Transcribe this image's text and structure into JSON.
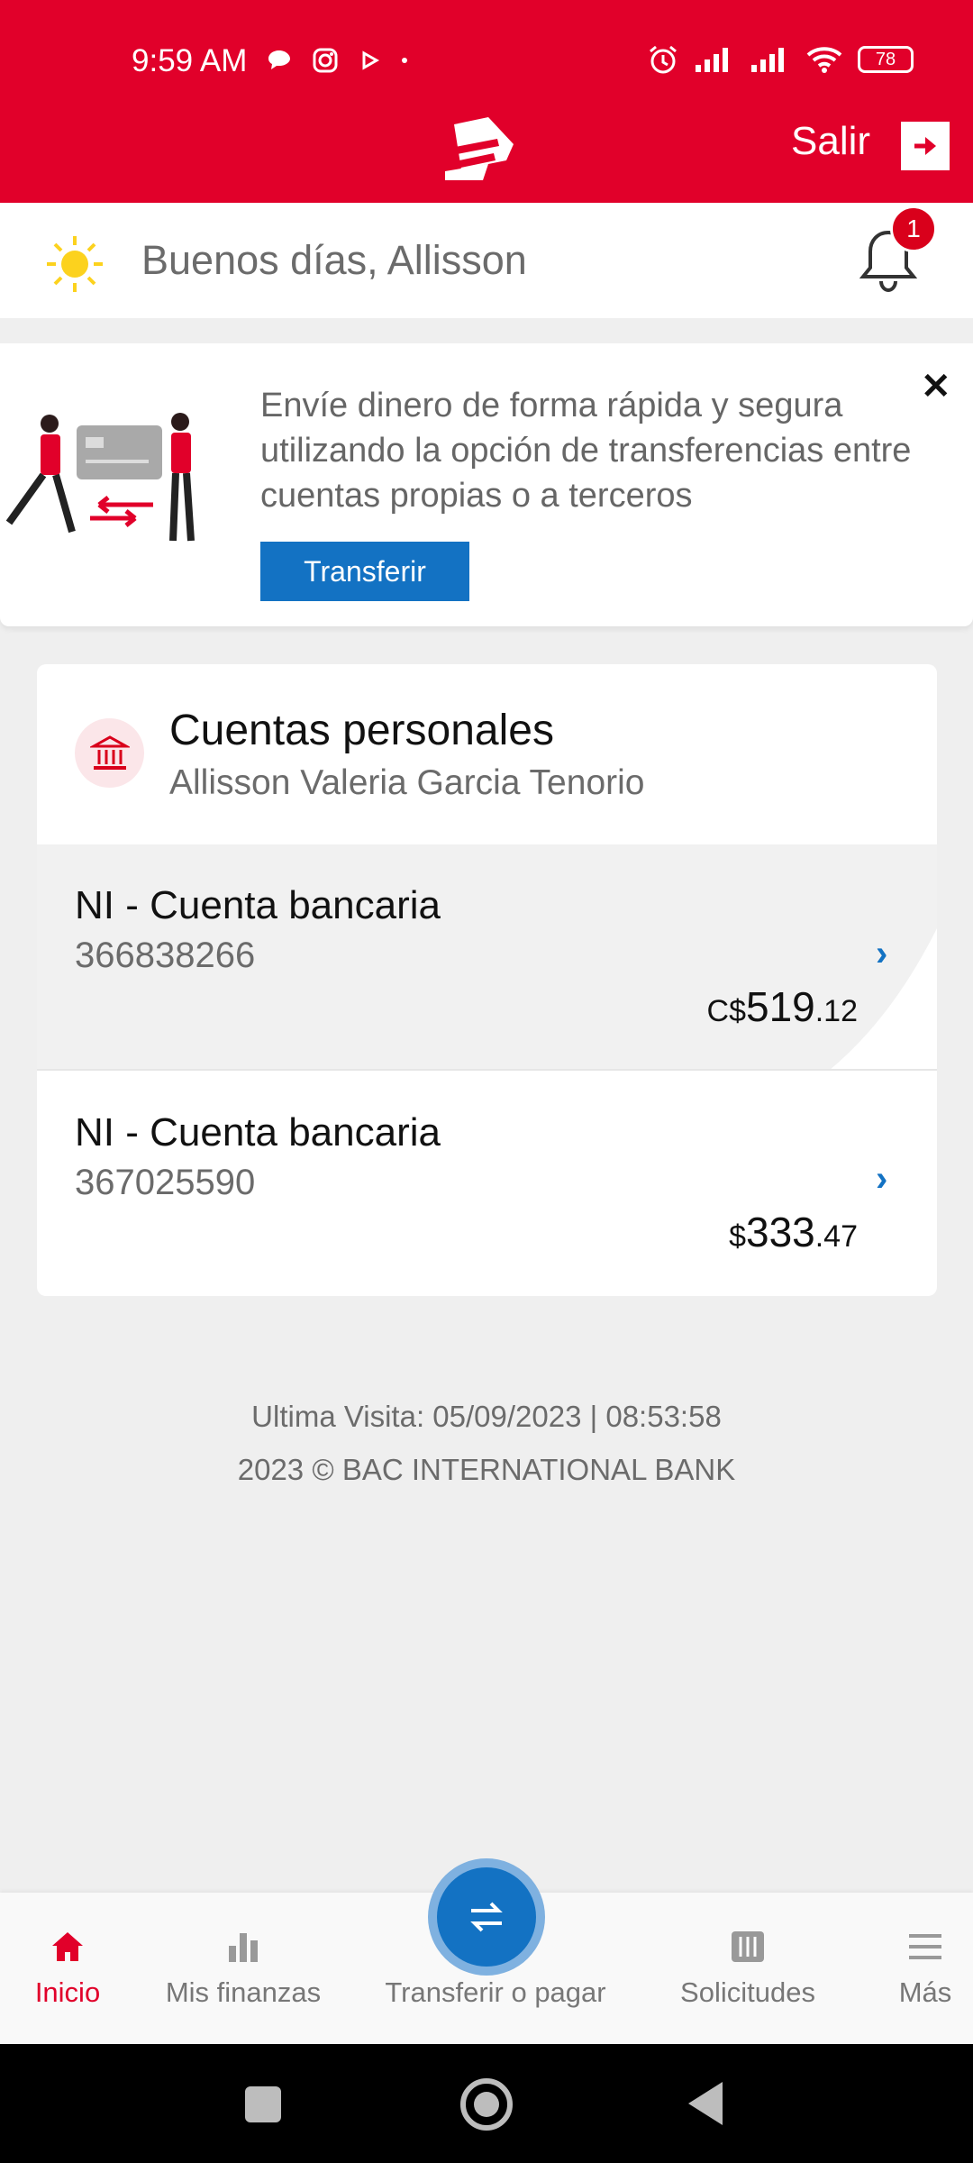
{
  "status_bar": {
    "time": "9:59 AM",
    "battery": "78"
  },
  "header": {
    "logout_label": "Salir"
  },
  "greeting": {
    "text": "Buenos días, Allisson",
    "notification_count": "1"
  },
  "promo": {
    "message": "Envíe dinero de forma rápida y segura utilizando la opción de transferencias entre cuentas propias o a terceros",
    "button_label": "Transferir",
    "close_label": "✕"
  },
  "accounts": {
    "title": "Cuentas personales",
    "owner": "Allisson Valeria Garcia Tenorio",
    "items": [
      {
        "name": "NI - Cuenta bancaria",
        "number": "366838266",
        "currency": "C$",
        "amount_int": "519",
        "amount_dec": ".12"
      },
      {
        "name": "NI - Cuenta bancaria",
        "number": "367025590",
        "currency": "$",
        "amount_int": "333",
        "amount_dec": ".47"
      }
    ]
  },
  "footer": {
    "last_visit": "Ultima Visita: 05/09/2023 | 08:53:58",
    "copyright": "2023 © BAC INTERNATIONAL BANK"
  },
  "bottom_nav": {
    "items": [
      {
        "label": "Inicio",
        "active": true
      },
      {
        "label": "Mis finanzas"
      },
      {
        "label": "Transferir o pagar"
      },
      {
        "label": "Solicitudes"
      },
      {
        "label": "Más"
      }
    ]
  },
  "colors": {
    "brand_red": "#e1002a",
    "accent_blue": "#1372c3"
  }
}
